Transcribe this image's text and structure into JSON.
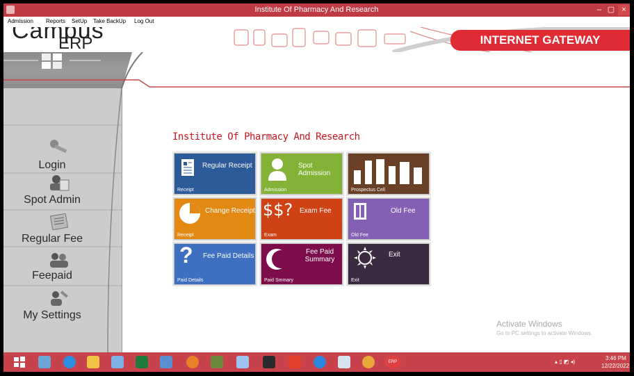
{
  "window": {
    "title": "Institute Of Pharmacy And Research",
    "controls": [
      "–",
      "▢",
      "×"
    ]
  },
  "menu": {
    "items": [
      "Admission",
      "Reports",
      "SetUp",
      "Take BackUp",
      "Log Out"
    ]
  },
  "header": {
    "logo_top": "Campus",
    "logo_bottom": "ERP",
    "gateway": "INTERNET GATEWAY"
  },
  "sidebar": {
    "items": [
      {
        "label": "Login",
        "icon": "key-icon"
      },
      {
        "label": "Spot Admin",
        "icon": "id-card-icon"
      },
      {
        "label": "Regular Fee",
        "icon": "list-icon"
      },
      {
        "label": "Feepaid",
        "icon": "users-icon"
      },
      {
        "label": "My Settings",
        "icon": "settings-user-icon"
      }
    ]
  },
  "main": {
    "title": "Institute Of Pharmacy And Research",
    "tiles": [
      {
        "label": "Regular Receipt",
        "sub": "Receipt",
        "color": "#2d5b99",
        "icon": "document-icon"
      },
      {
        "label": "Spot Admission",
        "sub": "Admission",
        "color": "#84b236",
        "icon": "person-icon"
      },
      {
        "label": "",
        "sub": "Prospectus Cell",
        "color": "#6a4126",
        "icon": "bars-icon"
      },
      {
        "label": "Change Receipt",
        "sub": "Receipt",
        "color": "#e28813",
        "icon": "pie-icon"
      },
      {
        "label": "Exam Fee",
        "sub": "Exam",
        "color": "#cf4216",
        "icon": "dollar-question-icon"
      },
      {
        "label": "Old Fee",
        "sub": "Old Fee",
        "color": "#8360b4",
        "icon": "book-icon"
      },
      {
        "label": "Fee Paid Details",
        "sub": "Paid Details",
        "color": "#3f6fc0",
        "icon": "question-icon"
      },
      {
        "label": "Fee Paid Summary",
        "sub": "Paid Smmary",
        "color": "#7c0d4a",
        "icon": "moon-icon"
      },
      {
        "label": "Exit",
        "sub": "Exit",
        "color": "#3b2a40",
        "icon": "sun-icon"
      }
    ],
    "dollar_glyph": "$$?"
  },
  "watermark": {
    "line1": "Activate Windows",
    "line2": "Go to PC settings to activate Windows."
  },
  "taskbar": {
    "time": "3:46 PM",
    "date": "12/22/2022",
    "erp_label": "ERP",
    "icons": [
      "start-icon",
      "tools-icon",
      "ie-icon",
      "file-explorer-icon",
      "monitor-icon",
      "excel-icon",
      "notepad-icon",
      "firefox-icon",
      "winamp-icon",
      "network-icon",
      "terminal-icon",
      "anydesk-icon",
      "teamviewer-icon",
      "office-icon",
      "chrome-icon",
      "erp-icon"
    ]
  }
}
